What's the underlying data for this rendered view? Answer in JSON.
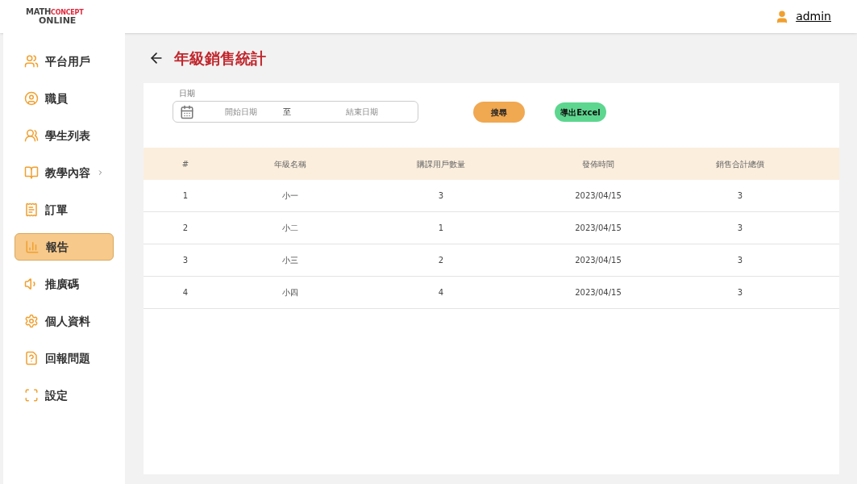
{
  "header": {
    "logo": {
      "line_1_dark": "MATH",
      "line_1_red": "CONCEPT",
      "line_2": "ONLINE"
    },
    "user": "admin"
  },
  "sidebar": {
    "items": [
      {
        "label": "平台用戶",
        "selected": false,
        "has_submenu": false
      },
      {
        "label": "職員",
        "selected": false,
        "has_submenu": false
      },
      {
        "label": "學生列表",
        "selected": false,
        "has_submenu": false
      },
      {
        "label": "教學內容",
        "selected": false,
        "has_submenu": true
      },
      {
        "label": "訂單",
        "selected": false,
        "has_submenu": false
      },
      {
        "label": "報告",
        "selected": true,
        "has_submenu": false
      },
      {
        "label": "推廣碼",
        "selected": false,
        "has_submenu": false
      },
      {
        "label": "個人資料",
        "selected": false,
        "has_submenu": false
      },
      {
        "label": "回報問題",
        "selected": false,
        "has_submenu": false
      },
      {
        "label": "設定",
        "selected": false,
        "has_submenu": false
      }
    ]
  },
  "page": {
    "title": "年級銷售統計",
    "filter": {
      "label": "日期",
      "start_placeholder": "開始日期",
      "separator": "至",
      "end_placeholder": "結束日期"
    },
    "buttons": {
      "search": "搜尋",
      "export": "導出Excel"
    },
    "table": {
      "columns": [
        "#",
        "年級名稱",
        "購課用戶數量",
        "發佈時間",
        "銷售合計總價"
      ],
      "rows": [
        [
          "1",
          "小一",
          "3",
          "2023/04/15",
          "3"
        ],
        [
          "2",
          "小二",
          "1",
          "2023/04/15",
          "3"
        ],
        [
          "3",
          "小三",
          "2",
          "2023/04/15",
          "3"
        ],
        [
          "4",
          "小四",
          "4",
          "2023/04/15",
          "3"
        ]
      ]
    }
  }
}
